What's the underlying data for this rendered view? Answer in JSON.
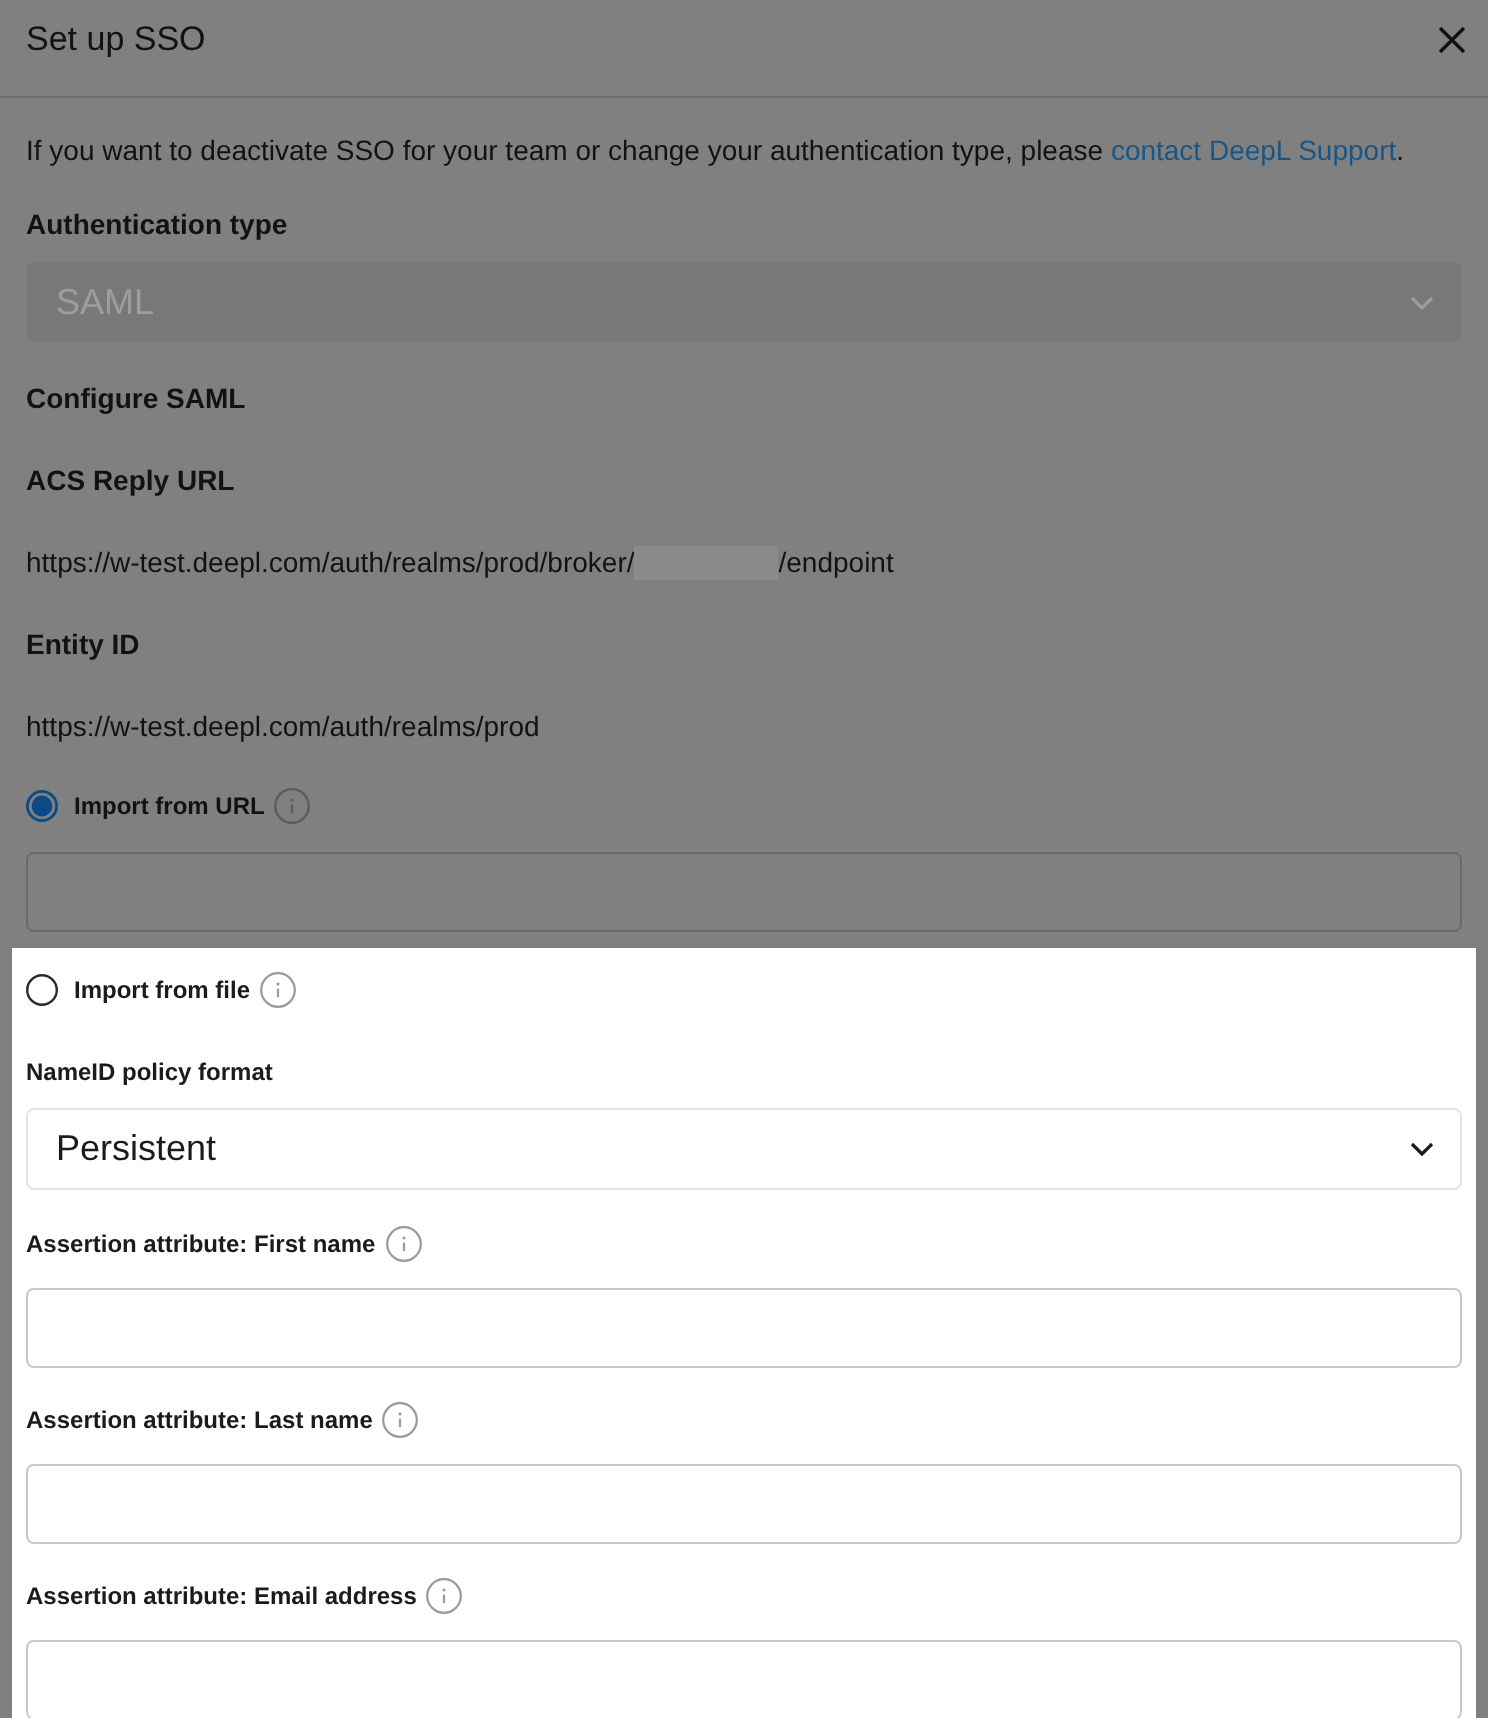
{
  "sections": [
    {
      "highlighted": false,
      "header": {
        "title": "Set up SSO"
      },
      "items": [
        {
          "kind": "paragraph",
          "text": "If you want to deactivate SSO for your team or change your authentication type, please ",
          "link": "contact DeepL Support",
          "tail": "."
        },
        {
          "kind": "heading",
          "text": "Authentication type"
        },
        {
          "kind": "select",
          "value": "SAML",
          "disabled": true
        },
        {
          "kind": "heading",
          "text": "Configure SAML"
        },
        {
          "kind": "heading",
          "text": "ACS Reply URL"
        },
        {
          "kind": "url",
          "text": "https://w-test.deepl.com/auth/realms/prod/broker/",
          "redacted": true,
          "tail": "/endpoint"
        },
        {
          "kind": "heading",
          "text": "Entity ID"
        },
        {
          "kind": "url",
          "text": "https://w-test.deepl.com/auth/realms/prod"
        },
        {
          "kind": "radio",
          "label": "Import from URL",
          "selected": true,
          "info": true
        },
        {
          "kind": "input"
        }
      ]
    },
    {
      "highlighted": true,
      "items": [
        {
          "kind": "radio",
          "label": "Import from file",
          "selected": false,
          "info": true
        },
        {
          "kind": "field_label",
          "text": "NameID policy format",
          "info": false
        },
        {
          "kind": "select",
          "value": "Persistent",
          "disabled": false
        },
        {
          "kind": "field_label",
          "text": "Assertion attribute: First name",
          "info": true
        },
        {
          "kind": "input"
        },
        {
          "kind": "field_label",
          "text": "Assertion attribute: Last name",
          "info": true
        },
        {
          "kind": "input"
        },
        {
          "kind": "field_label",
          "text": "Assertion attribute: Email address",
          "info": true
        },
        {
          "kind": "input"
        }
      ]
    }
  ]
}
